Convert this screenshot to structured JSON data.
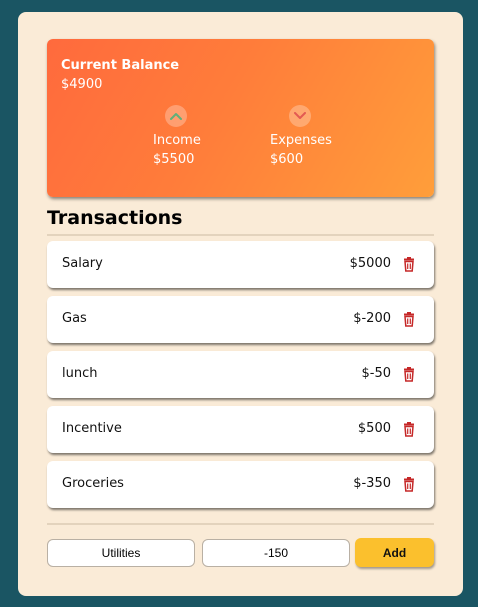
{
  "balance": {
    "title": "Current Balance",
    "value": "$4900",
    "income": {
      "label": "Income",
      "value": "$5500",
      "icon": "chevron-up-icon"
    },
    "expenses": {
      "label": "Expenses",
      "value": "$600",
      "icon": "chevron-down-icon"
    }
  },
  "transactions": {
    "title": "Transactions",
    "items": [
      {
        "name": "Salary",
        "amount": "$5000"
      },
      {
        "name": "Gas",
        "amount": "$-200"
      },
      {
        "name": "lunch",
        "amount": "$-50"
      },
      {
        "name": "Incentive",
        "amount": "$500"
      },
      {
        "name": "Groceries",
        "amount": "$-350"
      }
    ]
  },
  "form": {
    "text_value": "Utilities",
    "amount_value": "-150",
    "add_label": "Add"
  },
  "colors": {
    "page_bg": "#1a5563",
    "panel_bg": "#faebd7",
    "card_gradient_start": "#ff6a3d",
    "card_gradient_end": "#ff9e3a",
    "income_icon": "#5fb07a",
    "expense_icon": "#e35a52",
    "delete_icon": "#c62828",
    "add_button": "#fbc02d"
  }
}
